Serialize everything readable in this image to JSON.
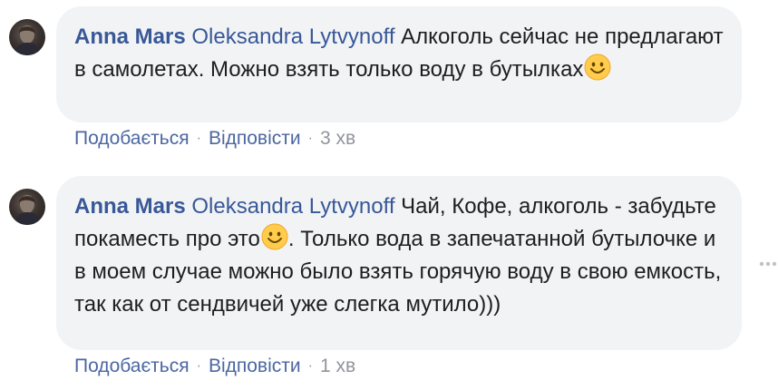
{
  "comments": [
    {
      "author": "Anna Mars",
      "mention": "Oleksandra Lytvynoff",
      "text_before_emoji": "Алкоголь сейчас не предлагают в самолетах. Можно взять только воду в бутылках",
      "text_after_emoji": "",
      "like_label": "Подобається",
      "reply_label": "Відповісти",
      "time": "3 хв"
    },
    {
      "author": "Anna Mars",
      "mention": "Oleksandra Lytvynoff",
      "text_before_emoji": "Чай, Кофе, алкоголь - забудьте покаместь про это",
      "text_after_emoji": ". Только вода в запечатанной бутылочке и в моем случае можно было взять горячую воду в свою емкость, так как от сендвичей уже слегка мутило)))",
      "like_label": "Подобається",
      "reply_label": "Відповісти",
      "time": "1 хв"
    }
  ],
  "separator": "·",
  "icons": {
    "emoji": "smiling-face-emoji",
    "options": "more-options-icon",
    "avatar": "avatar"
  },
  "colors": {
    "link": "#385898",
    "bubble_bg": "#f2f3f5",
    "meta_text": "#90949c",
    "emoji_face": "#ffcc4d"
  }
}
